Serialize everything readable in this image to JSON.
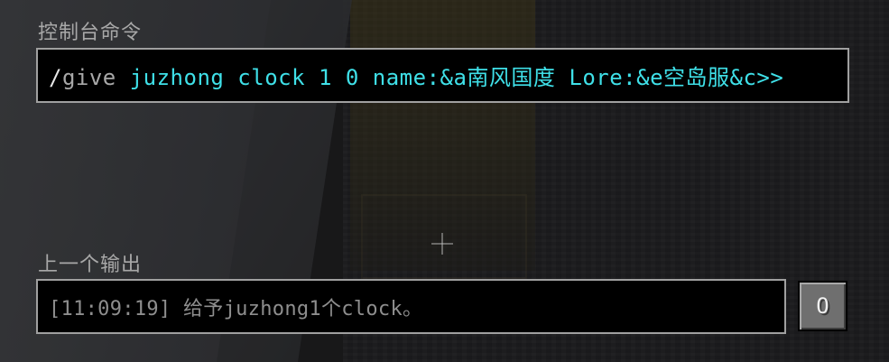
{
  "labels": {
    "command": "控制台命令",
    "previous_output": "上一个输出"
  },
  "command_input": {
    "slash": "/",
    "command": "give",
    "args": " juzhong clock 1 0 name:&a南风国度 Lore:&e空岛服&c>>"
  },
  "output": {
    "text": "[11:09:19] 给予juzhong1个clock。"
  },
  "track_output_button": {
    "label": "O"
  },
  "icons": {
    "crosshair": "crosshair-icon"
  },
  "colors": {
    "command_args": "#3fe0e8",
    "label": "#a8a8a8",
    "box_background": "#000000",
    "box_border": "#a0a0a0"
  }
}
